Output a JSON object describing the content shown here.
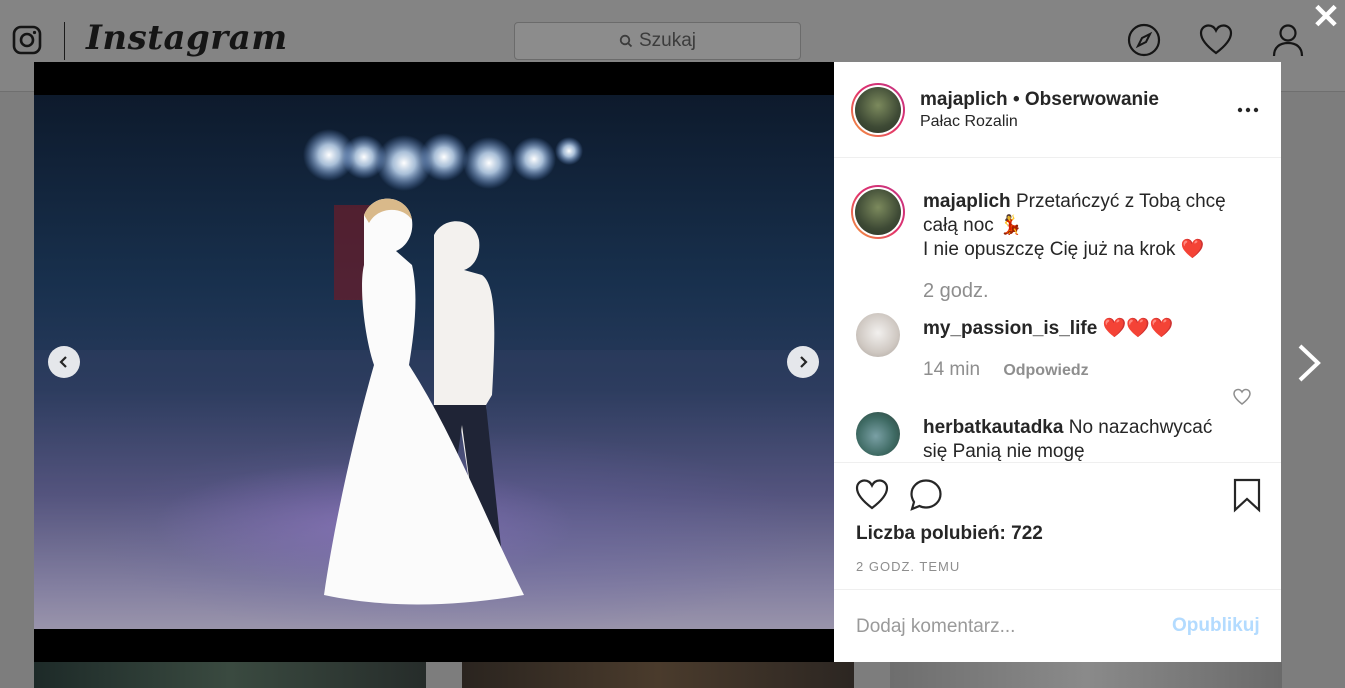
{
  "app": {
    "brand": "Instagram",
    "search_placeholder": "Szukaj"
  },
  "icons": {
    "logo": "instagram-glyph-icon",
    "explore": "compass-icon",
    "activity": "heart-icon",
    "profile": "person-icon",
    "close": "close-icon",
    "next_post": "chevron-right-icon",
    "prev_image": "chevron-left-icon",
    "next_image": "chevron-right-icon",
    "more": "ellipsis-icon",
    "like": "heart-icon",
    "comment": "speech-bubble-icon",
    "save": "bookmark-icon"
  },
  "post": {
    "username": "majaplich",
    "follow_state": "Obserwowanie",
    "location": "Pałac Rozalin",
    "caption_user": "majaplich",
    "caption_line1": "Przetańczyć z Tobą chcę całą noc 💃",
    "caption_line2": "I nie opuszczę Cię już na krok ❤️",
    "caption_time": "2 godz.",
    "comments": [
      {
        "user": "my_passion_is_life",
        "text": "❤️❤️❤️",
        "time": "14 min",
        "reply_label": "Odpowiedz"
      },
      {
        "user": "herbatkautadka",
        "text": "No nazachwycać się Panią nie mogę"
      }
    ],
    "likes_label": "Liczba polubień: 722",
    "posted_ago": "2 GODZ. TEMU",
    "comment_placeholder": "Dodaj komentarz...",
    "publish_label": "Opublikuj"
  },
  "colors": {
    "publish_disabled": "#b3dbff",
    "avatar_ring_start": "#f5a03a",
    "avatar_ring_end": "#c13584",
    "heart_red": "#e0245e"
  }
}
